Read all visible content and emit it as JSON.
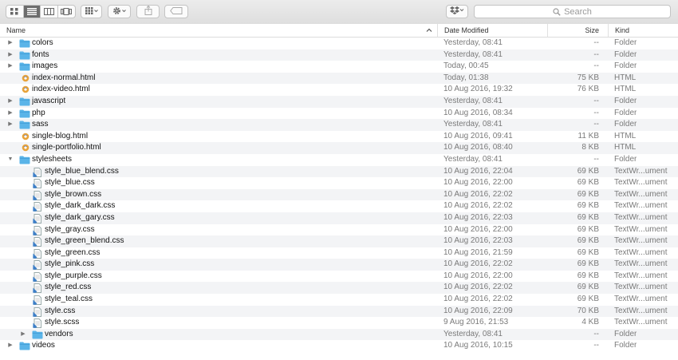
{
  "toolbar": {
    "view_modes": [
      "icon-view-icon",
      "list-view-icon",
      "column-view-icon",
      "cover-flow-icon"
    ],
    "arrange_icon": "grid-icon",
    "action_icon": "gear-icon",
    "share_icon": "share-icon",
    "tags_icon": "tag-icon",
    "dropbox_icon": "dropbox-icon",
    "search_placeholder": "Search"
  },
  "columns": {
    "name": "Name",
    "date": "Date Modified",
    "size": "Size",
    "kind": "Kind"
  },
  "rows": [
    {
      "name": "colors",
      "date": "Yesterday, 08:41",
      "size": "--",
      "kind": "Folder",
      "type": "folder",
      "indent": 0,
      "disclosure": "closed"
    },
    {
      "name": "fonts",
      "date": "Yesterday, 08:41",
      "size": "--",
      "kind": "Folder",
      "type": "folder",
      "indent": 0,
      "disclosure": "closed"
    },
    {
      "name": "images",
      "date": "Today, 00:45",
      "size": "--",
      "kind": "Folder",
      "type": "folder",
      "indent": 0,
      "disclosure": "closed"
    },
    {
      "name": "index-normal.html",
      "date": "Today, 01:38",
      "size": "75 KB",
      "kind": "HTML",
      "type": "html",
      "indent": 0,
      "disclosure": "none"
    },
    {
      "name": "index-video.html",
      "date": "10 Aug 2016, 19:32",
      "size": "76 KB",
      "kind": "HTML",
      "type": "html",
      "indent": 0,
      "disclosure": "none"
    },
    {
      "name": "javascript",
      "date": "Yesterday, 08:41",
      "size": "--",
      "kind": "Folder",
      "type": "folder",
      "indent": 0,
      "disclosure": "closed"
    },
    {
      "name": "php",
      "date": "10 Aug 2016, 08:34",
      "size": "--",
      "kind": "Folder",
      "type": "folder",
      "indent": 0,
      "disclosure": "closed"
    },
    {
      "name": "sass",
      "date": "Yesterday, 08:41",
      "size": "--",
      "kind": "Folder",
      "type": "folder",
      "indent": 0,
      "disclosure": "closed"
    },
    {
      "name": "single-blog.html",
      "date": "10 Aug 2016, 09:41",
      "size": "11 KB",
      "kind": "HTML",
      "type": "html",
      "indent": 0,
      "disclosure": "none"
    },
    {
      "name": "single-portfolio.html",
      "date": "10 Aug 2016, 08:40",
      "size": "8 KB",
      "kind": "HTML",
      "type": "html",
      "indent": 0,
      "disclosure": "none"
    },
    {
      "name": "stylesheets",
      "date": "Yesterday, 08:41",
      "size": "--",
      "kind": "Folder",
      "type": "folder",
      "indent": 0,
      "disclosure": "open"
    },
    {
      "name": "style_blue_blend.css",
      "date": "10 Aug 2016, 22:04",
      "size": "69 KB",
      "kind": "TextWr...ument",
      "type": "css",
      "indent": 1,
      "disclosure": "none"
    },
    {
      "name": "style_blue.css",
      "date": "10 Aug 2016, 22:00",
      "size": "69 KB",
      "kind": "TextWr...ument",
      "type": "css",
      "indent": 1,
      "disclosure": "none"
    },
    {
      "name": "style_brown.css",
      "date": "10 Aug 2016, 22:02",
      "size": "69 KB",
      "kind": "TextWr...ument",
      "type": "css",
      "indent": 1,
      "disclosure": "none"
    },
    {
      "name": "style_dark_dark.css",
      "date": "10 Aug 2016, 22:02",
      "size": "69 KB",
      "kind": "TextWr...ument",
      "type": "css",
      "indent": 1,
      "disclosure": "none"
    },
    {
      "name": "style_dark_gary.css",
      "date": "10 Aug 2016, 22:03",
      "size": "69 KB",
      "kind": "TextWr...ument",
      "type": "css",
      "indent": 1,
      "disclosure": "none"
    },
    {
      "name": "style_gray.css",
      "date": "10 Aug 2016, 22:00",
      "size": "69 KB",
      "kind": "TextWr...ument",
      "type": "css",
      "indent": 1,
      "disclosure": "none"
    },
    {
      "name": "style_green_blend.css",
      "date": "10 Aug 2016, 22:03",
      "size": "69 KB",
      "kind": "TextWr...ument",
      "type": "css",
      "indent": 1,
      "disclosure": "none"
    },
    {
      "name": "style_green.css",
      "date": "10 Aug 2016, 21:59",
      "size": "69 KB",
      "kind": "TextWr...ument",
      "type": "css",
      "indent": 1,
      "disclosure": "none"
    },
    {
      "name": "style_pink.css",
      "date": "10 Aug 2016, 22:02",
      "size": "69 KB",
      "kind": "TextWr...ument",
      "type": "css",
      "indent": 1,
      "disclosure": "none"
    },
    {
      "name": "style_purple.css",
      "date": "10 Aug 2016, 22:00",
      "size": "69 KB",
      "kind": "TextWr...ument",
      "type": "css",
      "indent": 1,
      "disclosure": "none"
    },
    {
      "name": "style_red.css",
      "date": "10 Aug 2016, 22:02",
      "size": "69 KB",
      "kind": "TextWr...ument",
      "type": "css",
      "indent": 1,
      "disclosure": "none"
    },
    {
      "name": "style_teal.css",
      "date": "10 Aug 2016, 22:02",
      "size": "69 KB",
      "kind": "TextWr...ument",
      "type": "css",
      "indent": 1,
      "disclosure": "none"
    },
    {
      "name": "style.css",
      "date": "10 Aug 2016, 22:09",
      "size": "70 KB",
      "kind": "TextWr...ument",
      "type": "css",
      "indent": 1,
      "disclosure": "none"
    },
    {
      "name": "style.scss",
      "date": "9 Aug 2016, 21:53",
      "size": "4 KB",
      "kind": "TextWr...ument",
      "type": "css",
      "indent": 1,
      "disclosure": "none"
    },
    {
      "name": "vendors",
      "date": "Yesterday, 08:41",
      "size": "--",
      "kind": "Folder",
      "type": "folder",
      "indent": 1,
      "disclosure": "closed"
    },
    {
      "name": "videos",
      "date": "10 Aug 2016, 10:15",
      "size": "--",
      "kind": "Folder",
      "type": "folder",
      "indent": 0,
      "disclosure": "closed"
    }
  ],
  "colors": {
    "folder": "#5ab4e8",
    "folder_tab": "#3e9ad4",
    "selected_segment": "#6c6c6c"
  }
}
